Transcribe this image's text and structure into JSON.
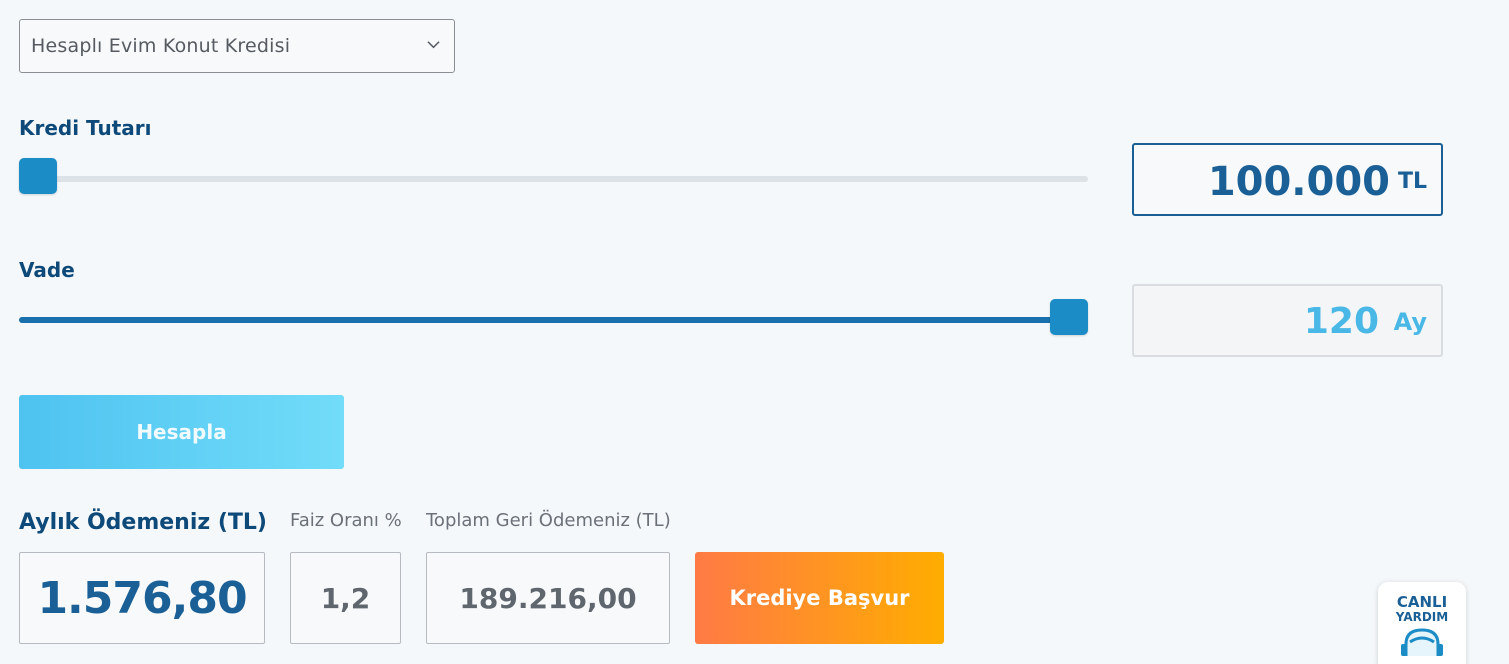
{
  "loan_type_select": {
    "selected": "Hesaplı Evim Konut Kredisi"
  },
  "amount": {
    "label": "Kredi Tutarı",
    "value": "100.000",
    "unit": "TL",
    "slider_fraction": 0.0
  },
  "term": {
    "label": "Vade",
    "value": "120",
    "unit": "Ay",
    "slider_fraction": 1.0
  },
  "calculate_button": {
    "label": "Hesapla"
  },
  "results": {
    "monthly_payment_label": "Aylık Ödemeniz (TL)",
    "monthly_payment_value": "1.576,80",
    "interest_rate_label": "Faiz Oranı %",
    "interest_rate_value": "1,2",
    "total_repayment_label": "Toplam Geri Ödemeniz (TL)",
    "total_repayment_value": "189.216,00"
  },
  "apply_button": {
    "label": "Krediye Başvur"
  },
  "live_help": {
    "line1": "CANLI",
    "line2": "YARDIM"
  },
  "colors": {
    "primary": "#0d4a7a",
    "slider": "#1b8cc6",
    "light_blue": "#4ec3f0",
    "orange": "#ff7a45",
    "yellow": "#ffad00"
  }
}
